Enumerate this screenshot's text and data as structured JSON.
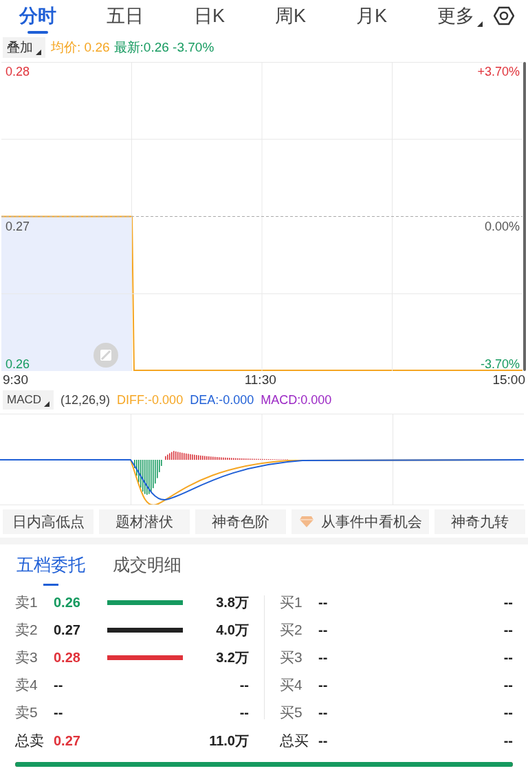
{
  "tabs": [
    {
      "label": "分时",
      "selected": true,
      "caret": false
    },
    {
      "label": "五日",
      "selected": false,
      "caret": false
    },
    {
      "label": "日K",
      "selected": false,
      "caret": false
    },
    {
      "label": "周K",
      "selected": false,
      "caret": false
    },
    {
      "label": "月K",
      "selected": false,
      "caret": false
    },
    {
      "label": "更多",
      "selected": false,
      "caret": true
    }
  ],
  "overlay_button": "叠加",
  "avg_price": "均价: 0.26",
  "latest": "最新:0.26 -3.70%",
  "price_chart": {
    "left_labels": [
      "0.28",
      "0.27",
      "0.26"
    ],
    "right_labels": [
      "+3.70%",
      "0.00%",
      "-3.70%"
    ],
    "time_labels": [
      "9:30",
      "11:30",
      "15:00"
    ]
  },
  "macd": {
    "button": "MACD",
    "params": "(12,26,9)",
    "diff": "DIFF:-0.000",
    "dea": "DEA:-0.000",
    "value": "MACD:0.000"
  },
  "shortcuts": [
    {
      "label": "日内高低点",
      "kind": "plain"
    },
    {
      "label": "题材潜伏",
      "kind": "plain"
    },
    {
      "label": "神奇色阶",
      "kind": "plain"
    },
    {
      "label": "从事件中看机会",
      "kind": "premium"
    },
    {
      "label": "神奇九转",
      "kind": "plain"
    }
  ],
  "book_tabs": [
    {
      "label": "五档委托",
      "selected": true
    },
    {
      "label": "成交明细",
      "selected": false
    }
  ],
  "sells": [
    {
      "label": "卖1",
      "price": "0.26",
      "color": "#159a5f",
      "volume": "3.8万",
      "bar": true
    },
    {
      "label": "卖2",
      "price": "0.27",
      "color": "#222222",
      "volume": "4.0万",
      "bar": true
    },
    {
      "label": "卖3",
      "price": "0.28",
      "color": "#e0323a",
      "volume": "3.2万",
      "bar": true
    },
    {
      "label": "卖4",
      "price": "--",
      "color": "#222222",
      "volume": "--",
      "bar": false
    },
    {
      "label": "卖5",
      "price": "--",
      "color": "#222222",
      "volume": "--",
      "bar": false
    }
  ],
  "buys": [
    {
      "label": "买1",
      "price": "--",
      "volume": "--"
    },
    {
      "label": "买2",
      "price": "--",
      "volume": "--"
    },
    {
      "label": "买3",
      "price": "--",
      "volume": "--"
    },
    {
      "label": "买4",
      "price": "--",
      "volume": "--"
    },
    {
      "label": "买5",
      "price": "--",
      "volume": "--"
    }
  ],
  "total_sell": {
    "label": "总卖",
    "price": "0.27",
    "color": "#e0323a",
    "volume": "11.0万"
  },
  "total_buy": {
    "label": "总买",
    "price": "--",
    "volume": "--"
  },
  "ratio_bar": {
    "level": 1
  }
}
